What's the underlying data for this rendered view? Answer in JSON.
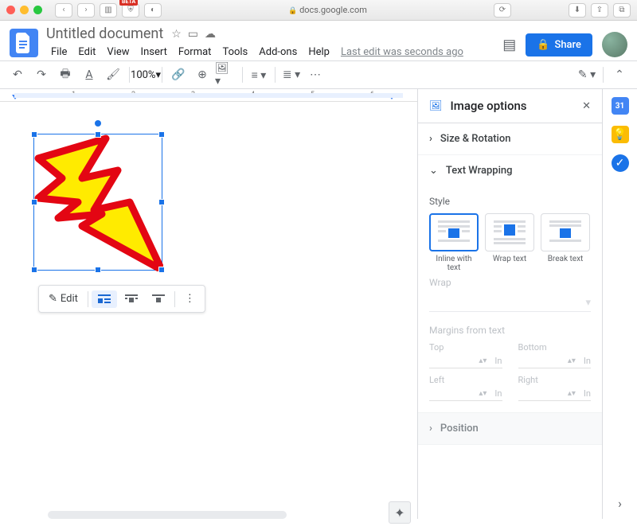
{
  "browser": {
    "url": "docs.google.com",
    "beta_badge": "BETA"
  },
  "doc": {
    "title": "Untitled document",
    "last_edit": "Last edit was seconds ago"
  },
  "menu": {
    "items": [
      "File",
      "Edit",
      "View",
      "Insert",
      "Format",
      "Tools",
      "Add-ons",
      "Help"
    ]
  },
  "share": {
    "label": "Share"
  },
  "toolbar": {
    "zoom": "100%"
  },
  "ruler": {
    "ticks": [
      "1",
      "2",
      "3",
      "4",
      "5",
      "6"
    ]
  },
  "ctx": {
    "edit": "Edit"
  },
  "panel": {
    "title": "Image options",
    "sections": {
      "size": "Size & Rotation",
      "wrap": "Text Wrapping",
      "position": "Position"
    },
    "style_label": "Style",
    "style_opts": {
      "inline": "Inline with text",
      "wrap": "Wrap text",
      "break": "Break text"
    },
    "wrap_label": "Wrap",
    "margins_label": "Margins from text",
    "margin_fields": {
      "top": "Top",
      "bottom": "Bottom",
      "left": "Left",
      "right": "Right"
    },
    "unit": "In"
  }
}
